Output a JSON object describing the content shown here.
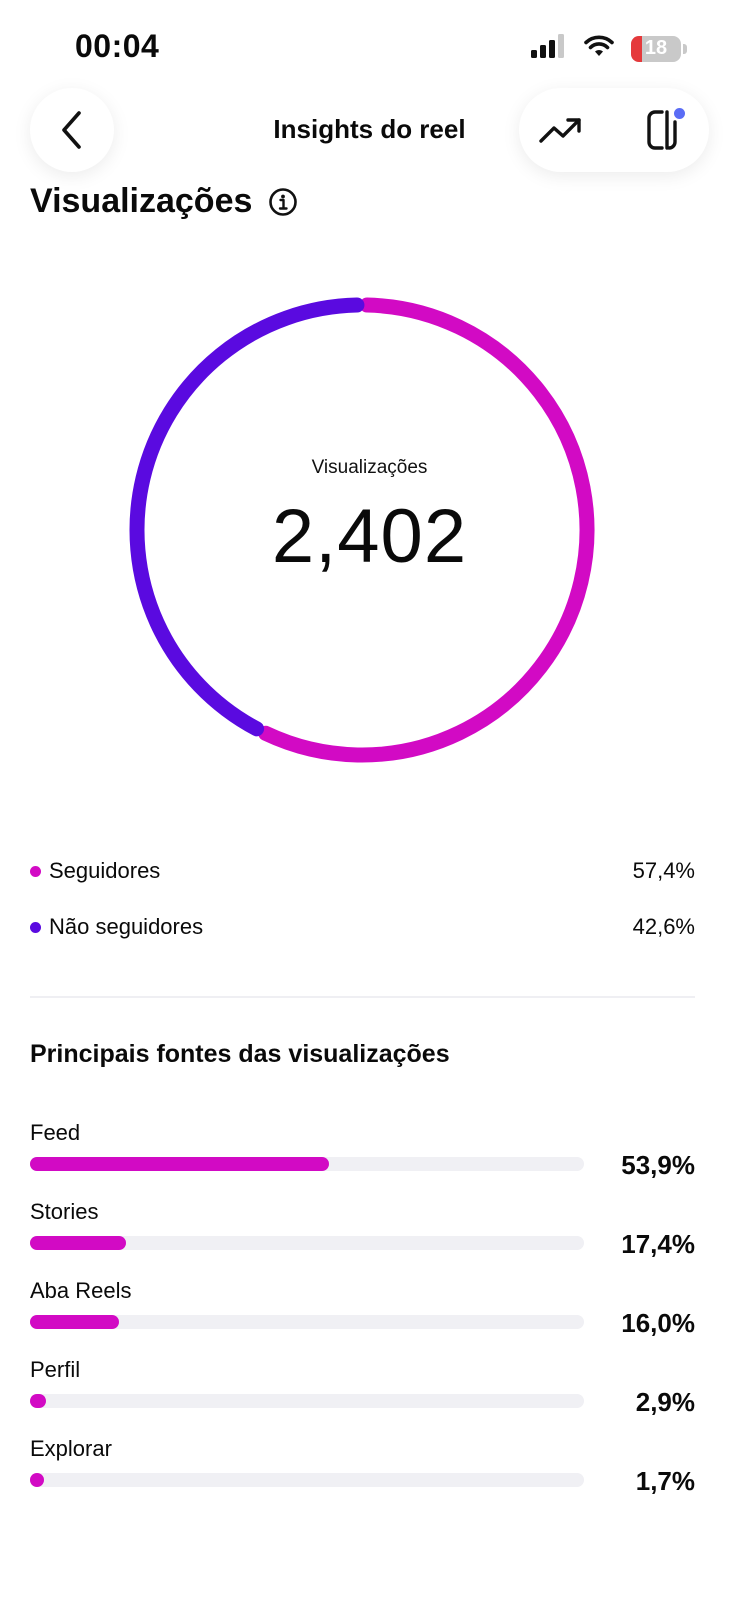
{
  "status_bar": {
    "time": "00:04",
    "battery": "18"
  },
  "header": {
    "title": "Insights do reel"
  },
  "section": {
    "title": "Visualizações"
  },
  "donut": {
    "label": "Visualizações",
    "value": "2,402",
    "colors": {
      "followers": "#d20ac4",
      "non_followers": "#5a0ae0"
    }
  },
  "legend": [
    {
      "label": "Seguidores",
      "value": "57,4%",
      "color": "#d20ac4"
    },
    {
      "label": "Não seguidores",
      "value": "42,6%",
      "color": "#5a0ae0"
    }
  ],
  "sources": {
    "title": "Principais fontes das visualizações",
    "items": [
      {
        "label": "Feed",
        "value": "53,9%",
        "fraction": 0.539
      },
      {
        "label": "Stories",
        "value": "17,4%",
        "fraction": 0.174
      },
      {
        "label": "Aba Reels",
        "value": "16,0%",
        "fraction": 0.16
      },
      {
        "label": "Perfil",
        "value": "2,9%",
        "fraction": 0.029
      },
      {
        "label": "Explorar",
        "value": "1,7%",
        "fraction": 0.017
      }
    ]
  }
}
